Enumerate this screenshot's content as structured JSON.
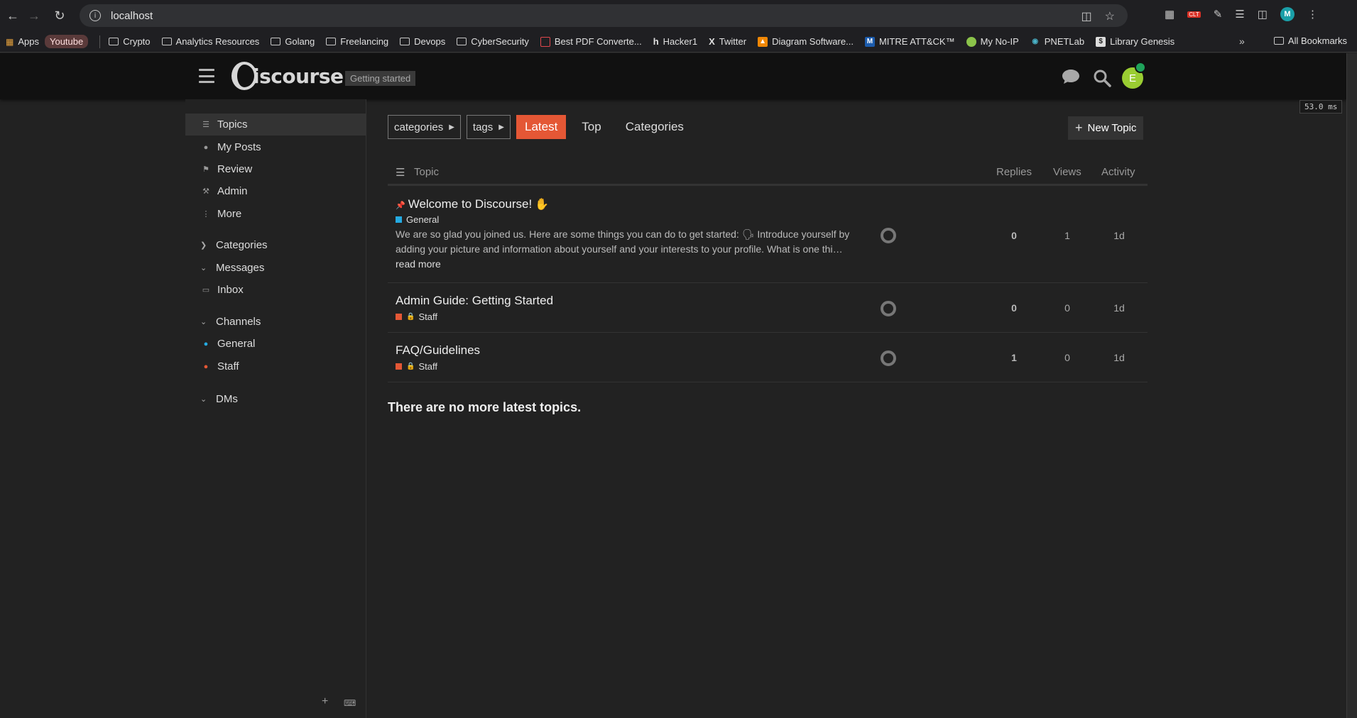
{
  "browser": {
    "url": "localhost",
    "bookmarks": [
      {
        "label": "Apps"
      },
      {
        "label": "Youtube"
      },
      {
        "label": "Crypto"
      },
      {
        "label": "Analytics Resources"
      },
      {
        "label": "Golang"
      },
      {
        "label": "Freelancing"
      },
      {
        "label": "Devops"
      },
      {
        "label": "CyberSecurity"
      },
      {
        "label": "Best PDF Converte..."
      },
      {
        "label": "Hacker1"
      },
      {
        "label": "Twitter"
      },
      {
        "label": "Diagram Software..."
      },
      {
        "label": "MITRE ATT&CK™"
      },
      {
        "label": "My No-IP"
      },
      {
        "label": "PNETLab"
      },
      {
        "label": "Library Genesis"
      }
    ],
    "all_bookmarks": "All Bookmarks",
    "profile_initial": "M",
    "ext_badge": "CLT"
  },
  "header": {
    "logo_text": "iscourse",
    "badge": "Getting started",
    "avatar_initial": "E",
    "timing": "53.0 ms"
  },
  "sidebar": {
    "items": [
      {
        "label": "Topics",
        "icon": "layers-icon"
      },
      {
        "label": "My Posts",
        "icon": "user-icon"
      },
      {
        "label": "Review",
        "icon": "flag-icon"
      },
      {
        "label": "Admin",
        "icon": "wrench-icon"
      },
      {
        "label": "More",
        "icon": "ellipsis-icon"
      }
    ],
    "sections": {
      "categories": "Categories",
      "messages": "Messages",
      "inbox": "Inbox",
      "channels": "Channels",
      "general": "General",
      "staff": "Staff",
      "dms": "DMs"
    }
  },
  "nav": {
    "categories_dd": "categories",
    "tags_dd": "tags",
    "latest": "Latest",
    "top": "Top",
    "categories": "Categories",
    "new_topic": "New Topic"
  },
  "table": {
    "headers": {
      "topic": "Topic",
      "replies": "Replies",
      "views": "Views",
      "activity": "Activity"
    },
    "rows": [
      {
        "title": "Welcome to Discourse!",
        "category": "General",
        "category_color": "#25aae1",
        "excerpt": "We are so glad you joined us. Here are some things you can do to get started: 🗣 Introduce yourself by adding your picture and information about yourself and your interests to your profile. What is one thi…",
        "read_more": "read more",
        "replies": "0",
        "views": "1",
        "activity": "1d"
      },
      {
        "title": "Admin Guide: Getting Started",
        "category": "Staff",
        "category_color": "#e45735",
        "replies": "0",
        "views": "0",
        "activity": "1d"
      },
      {
        "title": "FAQ/Guidelines",
        "category": "Staff",
        "category_color": "#e45735",
        "replies": "1",
        "views": "0",
        "activity": "1d"
      }
    ],
    "footer": "There are no more latest topics."
  },
  "colors": {
    "accent": "#e45735",
    "background": "#222222",
    "header": "#111111"
  }
}
